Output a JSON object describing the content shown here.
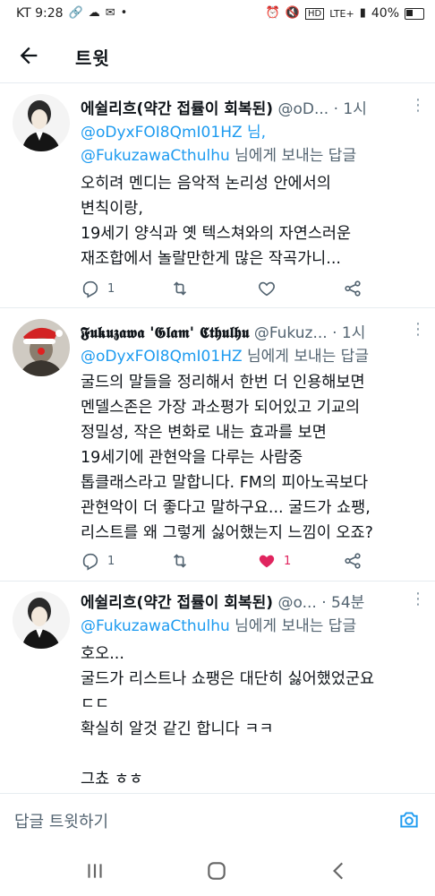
{
  "status_bar": {
    "carrier_time": "KT 9:28",
    "network": "LTE+",
    "battery": "40%"
  },
  "app_bar": {
    "title": "트윗"
  },
  "tweets": [
    {
      "name": "에쉴리흐(약간 접률이 회복된)",
      "handle": "@oD...",
      "time": "1시",
      "reply_mentions": "@oDyxFOI8QmI01HZ 님,\n@FukuzawaCthulhu",
      "reply_suffix": " 님에게 보내는 답글",
      "text": "오히려 멘디는 음악적 논리성 안에서의\n변칙이랑,\n19세기 양식과 옛 텍스쳐와의 자연스러운\n재조합에서 놀랄만한게 많은 작곡가니...",
      "reply_count": "1",
      "retweet_count": "",
      "like_count": ""
    },
    {
      "name": "𝕱𝖚𝖐𝖚𝖟𝖆𝖜𝖆 '𝕲𝖑𝖆𝖒' 𝕮𝖙𝖍𝖚𝖑𝖍𝖚",
      "handle": "@Fukuz...",
      "time": "1시",
      "reply_mentions": "@oDyxFOI8QmI01HZ",
      "reply_suffix": " 님에게 보내는 답글",
      "text": "굴드의 말들을 정리해서 한번 더 인용해보면\n멘델스존은 가장 과소평가 되어있고 기교의\n정밀성, 작은 변화로 내는 효과를 보면\n19세기에 관현악을 다루는 사람중\n톱클래스라고 말합니다. FM의 피아노곡보다\n관현악이 더 좋다고 말하구요... 굴드가 쇼팽,\n리스트를 왜 그렇게 싫어했는지 느낌이 오죠?",
      "reply_count": "1",
      "retweet_count": "",
      "like_count": "1"
    },
    {
      "name": "에쉴리흐(약간 접률이 회복된)",
      "handle": "@o...",
      "time": "54분",
      "reply_mentions": "@FukuzawaCthulhu",
      "reply_suffix": " 님에게 보내는 답글",
      "text": "호오...\n굴드가 리스트나 쇼팽은 대단히 싫어했었군요\nㄷㄷ\n확실히 알것 같긴 합니다 ㅋㅋ\n\n그쵸 ㅎㅎ"
    }
  ],
  "composer": {
    "placeholder": "답글 트윗하기"
  },
  "colors": {
    "accent": "#1d9bf0",
    "like": "#e0245e",
    "secondary_text": "#536471"
  }
}
